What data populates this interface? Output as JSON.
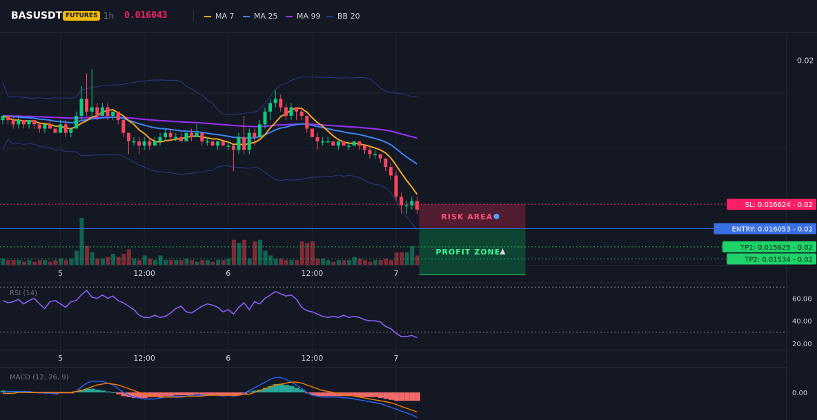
{
  "header": {
    "symbol": "BASUSDT",
    "badge": "FUTURES",
    "timeframe": "1h",
    "last_price": "0.016043",
    "indicators": [
      {
        "label": "MA 7",
        "color": "#f5a623"
      },
      {
        "label": "MA 25",
        "color": "#3b82f6"
      },
      {
        "label": "MA 99",
        "color": "#9b30ff"
      },
      {
        "label": "BB 20",
        "color": "#1e3a8a"
      }
    ]
  },
  "colors": {
    "up": "#0ecb81",
    "down": "#f6465d",
    "background": "#141823",
    "grid": "#1f2430"
  },
  "chart_data": {
    "type": "candlestick",
    "price_axis_ticks": [
      {
        "value": 0.02,
        "label": "0.02"
      }
    ],
    "time_ticks": [
      {
        "index": 11,
        "label": "5"
      },
      {
        "index": 27,
        "label": "12:00"
      },
      {
        "index": 43,
        "label": "6"
      },
      {
        "index": 59,
        "label": "12:00"
      },
      {
        "index": 75,
        "label": "7"
      }
    ],
    "candles": [
      [
        0.0186,
        0.0187,
        0.0185,
        0.0187
      ],
      [
        0.0187,
        0.0187,
        0.0185,
        0.0186
      ],
      [
        0.0186,
        0.0187,
        0.0184,
        0.0185
      ],
      [
        0.0185,
        0.0187,
        0.0184,
        0.0186
      ],
      [
        0.0186,
        0.0186,
        0.0184,
        0.0185
      ],
      [
        0.0185,
        0.0186,
        0.0184,
        0.0186
      ],
      [
        0.0186,
        0.0186,
        0.0184,
        0.0185
      ],
      [
        0.0185,
        0.0185,
        0.0183,
        0.0184
      ],
      [
        0.0184,
        0.0185,
        0.0183,
        0.0185
      ],
      [
        0.0185,
        0.0186,
        0.0184,
        0.0184
      ],
      [
        0.0184,
        0.0184,
        0.0183,
        0.0183
      ],
      [
        0.0183,
        0.0186,
        0.0183,
        0.0185
      ],
      [
        0.0185,
        0.0186,
        0.0182,
        0.0183
      ],
      [
        0.0183,
        0.0184,
        0.0182,
        0.0184
      ],
      [
        0.0184,
        0.0188,
        0.0184,
        0.0187
      ],
      [
        0.0187,
        0.0194,
        0.0186,
        0.0191
      ],
      [
        0.0191,
        0.0197,
        0.0187,
        0.0188
      ],
      [
        0.0188,
        0.0198,
        0.0187,
        0.0189
      ],
      [
        0.0189,
        0.019,
        0.0186,
        0.0187
      ],
      [
        0.0187,
        0.019,
        0.0187,
        0.0189
      ],
      [
        0.0189,
        0.019,
        0.0186,
        0.0187
      ],
      [
        0.0187,
        0.0188,
        0.0186,
        0.0188
      ],
      [
        0.0188,
        0.0188,
        0.0185,
        0.0186
      ],
      [
        0.0186,
        0.0186,
        0.0182,
        0.0183
      ],
      [
        0.0183,
        0.0183,
        0.0178,
        0.0181
      ],
      [
        0.0181,
        0.0182,
        0.018,
        0.0181
      ],
      [
        0.0181,
        0.0182,
        0.0178,
        0.018
      ],
      [
        0.018,
        0.0182,
        0.0179,
        0.0181
      ],
      [
        0.0181,
        0.0182,
        0.0179,
        0.018
      ],
      [
        0.018,
        0.0182,
        0.018,
        0.0181
      ],
      [
        0.0181,
        0.0183,
        0.018,
        0.0182
      ],
      [
        0.0182,
        0.0184,
        0.0181,
        0.0183
      ],
      [
        0.0183,
        0.0184,
        0.0181,
        0.0182
      ],
      [
        0.0182,
        0.0183,
        0.0181,
        0.0182
      ],
      [
        0.0182,
        0.0183,
        0.0181,
        0.0181
      ],
      [
        0.0181,
        0.0183,
        0.0181,
        0.0183
      ],
      [
        0.0183,
        0.0184,
        0.0181,
        0.0182
      ],
      [
        0.0182,
        0.0185,
        0.0182,
        0.0183
      ],
      [
        0.0183,
        0.0183,
        0.018,
        0.0181
      ],
      [
        0.0181,
        0.0182,
        0.018,
        0.0181
      ],
      [
        0.0181,
        0.0181,
        0.018,
        0.018
      ],
      [
        0.018,
        0.0181,
        0.0179,
        0.0181
      ],
      [
        0.0181,
        0.0181,
        0.018,
        0.018
      ],
      [
        0.018,
        0.0181,
        0.0179,
        0.018
      ],
      [
        0.018,
        0.018,
        0.0174,
        0.0179
      ],
      [
        0.0179,
        0.0183,
        0.0178,
        0.0182
      ],
      [
        0.0182,
        0.0187,
        0.0178,
        0.0179
      ],
      [
        0.0179,
        0.0184,
        0.0178,
        0.0183
      ],
      [
        0.0183,
        0.0184,
        0.018,
        0.0182
      ],
      [
        0.0182,
        0.0186,
        0.0182,
        0.0185
      ],
      [
        0.0185,
        0.0189,
        0.0184,
        0.0188
      ],
      [
        0.0188,
        0.0191,
        0.0186,
        0.019
      ],
      [
        0.019,
        0.0193,
        0.0189,
        0.0191
      ],
      [
        0.0191,
        0.0192,
        0.0188,
        0.0189
      ],
      [
        0.0189,
        0.019,
        0.0186,
        0.0187
      ],
      [
        0.0187,
        0.019,
        0.0186,
        0.0189
      ],
      [
        0.0189,
        0.0189,
        0.0186,
        0.0188
      ],
      [
        0.0188,
        0.0189,
        0.0186,
        0.0187
      ],
      [
        0.0187,
        0.0187,
        0.0183,
        0.0184
      ],
      [
        0.0184,
        0.0184,
        0.0182,
        0.0182
      ],
      [
        0.0182,
        0.0183,
        0.0179,
        0.0181
      ],
      [
        0.0181,
        0.0182,
        0.018,
        0.0181
      ],
      [
        0.0181,
        0.0182,
        0.0181,
        0.0181
      ],
      [
        0.0181,
        0.0181,
        0.018,
        0.018
      ],
      [
        0.018,
        0.0181,
        0.0179,
        0.0181
      ],
      [
        0.0181,
        0.0181,
        0.018,
        0.018
      ],
      [
        0.018,
        0.0181,
        0.0179,
        0.018
      ],
      [
        0.018,
        0.0181,
        0.018,
        0.0181
      ],
      [
        0.0181,
        0.0181,
        0.0179,
        0.018
      ],
      [
        0.018,
        0.018,
        0.0178,
        0.0179
      ],
      [
        0.0179,
        0.018,
        0.0177,
        0.0178
      ],
      [
        0.0178,
        0.0179,
        0.0177,
        0.0178
      ],
      [
        0.0178,
        0.0178,
        0.0176,
        0.0177
      ],
      [
        0.0177,
        0.0177,
        0.0174,
        0.0175
      ],
      [
        0.0175,
        0.0176,
        0.0172,
        0.0173
      ],
      [
        0.0173,
        0.0174,
        0.0167,
        0.0168
      ],
      [
        0.0168,
        0.0169,
        0.0164,
        0.0166
      ],
      [
        0.0166,
        0.0167,
        0.0164,
        0.0166
      ],
      [
        0.0166,
        0.0168,
        0.0165,
        0.0167
      ],
      [
        0.0167,
        0.0168,
        0.0164,
        0.0165
      ]
    ],
    "volumes": [
      4,
      3,
      3,
      3,
      2,
      3,
      2,
      3,
      3,
      2,
      3,
      4,
      3,
      4,
      9,
      30,
      12,
      8,
      4,
      4,
      5,
      7,
      5,
      7,
      10,
      4,
      3,
      6,
      4,
      3,
      6,
      3,
      3,
      3,
      3,
      4,
      3,
      2,
      3,
      3,
      2,
      3,
      3,
      4,
      16,
      14,
      16,
      4,
      15,
      16,
      9,
      6,
      4,
      4,
      3,
      3,
      3,
      15,
      14,
      15,
      4,
      4,
      3,
      2,
      3,
      3,
      3,
      5,
      4,
      3,
      2,
      3,
      3,
      4,
      3,
      8,
      8,
      8,
      12,
      6
    ],
    "orders": [
      {
        "key": "sl",
        "price": 0.016624,
        "label": "SL: 0.016624 - 0.02",
        "color": "#ff1f66"
      },
      {
        "key": "entry",
        "price": 0.016053,
        "label": "ENTRY: 0.016053 - 0.02",
        "color": "#3b6fe6"
      },
      {
        "key": "tp1",
        "price": 0.015625,
        "label": "TP1: 0.015625 - 0.02",
        "color": "#1fd36a"
      },
      {
        "key": "tp2",
        "price": 0.01534,
        "label": "TP2: 0.01534 - 0.02",
        "color": "#1fd36a"
      }
    ],
    "zones": {
      "risk": "RISK AREA",
      "profit": "PROFIT ZONE"
    },
    "rsi": {
      "label": "RSI (14)",
      "ticks": [
        "60.00",
        "40.00",
        "20.00"
      ],
      "tick_values": [
        60,
        40,
        20
      ],
      "bands": [
        70,
        30
      ],
      "values": [
        58,
        56,
        57,
        59,
        55,
        58,
        60,
        55,
        51,
        57,
        58,
        55,
        52,
        57,
        58,
        63,
        67,
        61,
        60,
        63,
        60,
        62,
        58,
        56,
        53,
        50,
        45,
        43,
        43,
        45,
        43,
        44,
        47,
        51,
        53,
        48,
        47,
        50,
        53,
        55,
        54,
        52,
        48,
        50,
        46,
        52,
        56,
        50,
        57,
        55,
        60,
        63,
        66,
        64,
        62,
        63,
        59,
        52,
        49,
        48,
        46,
        44,
        43,
        44,
        43,
        45,
        43,
        44,
        43,
        41,
        40,
        40,
        39,
        35,
        33,
        29,
        26,
        26,
        27,
        25
      ]
    },
    "macd": {
      "label": "MACD (12, 26, 9)",
      "tick": "0.00",
      "tick_value": 0,
      "hist": [
        2,
        1,
        1,
        1,
        1,
        0,
        0,
        -1,
        -1,
        -1,
        -2,
        -1,
        -1,
        -1,
        1,
        3,
        4,
        4,
        3,
        2,
        1,
        0,
        -2,
        -4,
        -5,
        -6,
        -6,
        -6,
        -5,
        -5,
        -5,
        -4,
        -4,
        -3,
        -3,
        -3,
        -3,
        -2,
        -3,
        -3,
        -3,
        -3,
        -3,
        -3,
        -4,
        -3,
        -2,
        1,
        2,
        3,
        5,
        7,
        9,
        9,
        8,
        7,
        5,
        3,
        -1,
        -3,
        -4,
        -4,
        -4,
        -4,
        -4,
        -4,
        -4,
        -4,
        -5,
        -5,
        -5,
        -5,
        -6,
        -7,
        -8,
        -9,
        -9,
        -9,
        -9,
        -9
      ],
      "macd": [
        0,
        1,
        1,
        1,
        1,
        1,
        0,
        0,
        -1,
        -1,
        -1,
        0,
        0,
        0,
        1,
        6,
        10,
        12,
        12,
        12,
        10,
        8,
        4,
        0,
        -3,
        -5,
        -6,
        -7,
        -7,
        -7,
        -6,
        -5,
        -4,
        -4,
        -4,
        -4,
        -3,
        -3,
        -3,
        -3,
        -3,
        -3,
        -4,
        -3,
        -4,
        -3,
        -1,
        2,
        5,
        8,
        11,
        14,
        16,
        16,
        14,
        11,
        8,
        4,
        0,
        -3,
        -4,
        -5,
        -5,
        -5,
        -5,
        -6,
        -6,
        -7,
        -8,
        -9,
        -10,
        -11,
        -12,
        -14,
        -16,
        -18,
        -20,
        -22,
        -24,
        -27
      ],
      "signal": [
        -1,
        -1,
        -1,
        0,
        0,
        0,
        0,
        0,
        0,
        0,
        0,
        0,
        0,
        0,
        1,
        2,
        4,
        6,
        8,
        9,
        10,
        9,
        8,
        6,
        4,
        2,
        0,
        -2,
        -3,
        -4,
        -5,
        -5,
        -5,
        -5,
        -5,
        -4,
        -4,
        -4,
        -4,
        -3,
        -3,
        -3,
        -3,
        -3,
        -3,
        -3,
        -2,
        -2,
        0,
        2,
        4,
        6,
        8,
        9,
        10,
        11,
        11,
        10,
        8,
        6,
        4,
        2,
        1,
        0,
        -1,
        -2,
        -3,
        -4,
        -5,
        -6,
        -7,
        -8,
        -9,
        -10,
        -11,
        -13,
        -15,
        -17,
        -19,
        -21
      ]
    }
  }
}
